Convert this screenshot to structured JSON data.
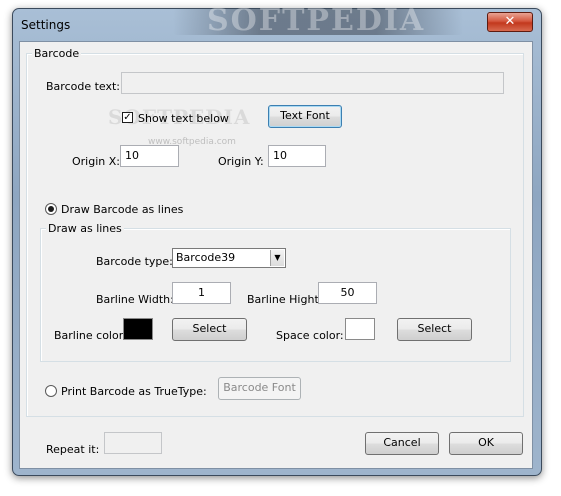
{
  "window": {
    "title": "Settings",
    "close_glyph": "✕",
    "watermark_text": "SOFTPEDIA",
    "watermark_sub": "www.softpedia.com"
  },
  "barcode_group": {
    "legend": "Barcode",
    "barcode_text_label": "Barcode text:",
    "barcode_text_value": "",
    "show_text_below_label": "Show text below",
    "show_text_below_checked": true,
    "text_font_button": "Text Font",
    "origin_x_label": "Origin X:",
    "origin_x_value": "10",
    "origin_y_label": "Origin Y:",
    "origin_y_value": "10"
  },
  "draw_lines_radio": {
    "label": "Draw Barcode as lines",
    "selected": true
  },
  "draw_as_lines_group": {
    "legend": "Draw as lines",
    "barcode_type_label": "Barcode type:",
    "barcode_type_value": "Barcode39",
    "barline_width_label": "Barline Width:",
    "barline_width_value": "1",
    "barline_hight_label": "Barline Hight:",
    "barline_hight_value": "50",
    "barline_color_label": "Barline color:",
    "barline_color": "#000000",
    "barline_select_button": "Select",
    "space_color_label": "Space color:",
    "space_color": "#ffffff",
    "space_select_button": "Select"
  },
  "truetype_radio": {
    "label": "Print Barcode as TrueType:",
    "selected": false,
    "barcode_font_button": "Barcode Font"
  },
  "footer": {
    "repeat_label": "Repeat it:",
    "repeat_value": "",
    "cancel_button": "Cancel",
    "ok_button": "OK"
  },
  "colors": {
    "dialog_background": "#f0f0f0",
    "title_bar": "#9eb4cc",
    "close_button": "#c2381d"
  },
  "icons": {
    "check": "check-icon",
    "close": "close-icon",
    "dropdown": "chevron-down-icon"
  }
}
